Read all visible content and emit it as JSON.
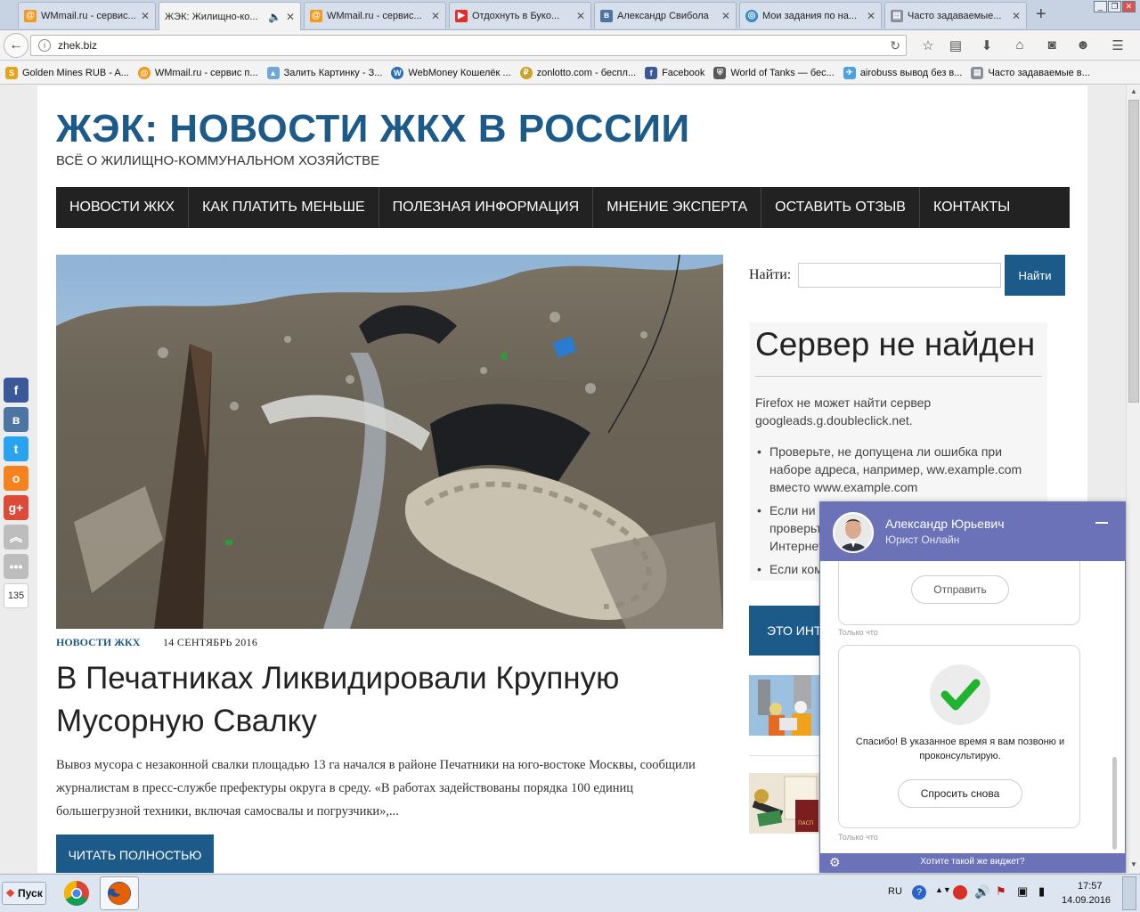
{
  "browser": {
    "tabs": [
      {
        "title": "WMmail.ru - сервис...",
        "icon": "mail-at-icon",
        "active": false
      },
      {
        "title": "ЖЭК: Жилищно-ко...",
        "icon": "page-icon",
        "active": true
      },
      {
        "title": "WMmail.ru - сервис...",
        "icon": "mail-at-icon",
        "active": false
      },
      {
        "title": "Отдохнуть в Буко...",
        "icon": "youtube-icon",
        "active": false
      },
      {
        "title": "Александр Свибола",
        "icon": "vk-icon",
        "active": false
      },
      {
        "title": "Мои задания по на...",
        "icon": "target-icon",
        "active": false
      },
      {
        "title": "Часто задаваемые...",
        "icon": "doc-icon",
        "active": false
      }
    ],
    "new_tab": "+",
    "url": "zhek.biz",
    "bookmarks": [
      {
        "label": "Golden Mines RUB - A..."
      },
      {
        "label": "WMmail.ru - сервис п..."
      },
      {
        "label": "Залить Картинку - З..."
      },
      {
        "label": "WebMoney Кошелёк ..."
      },
      {
        "label": "zonlotto.com - беспл..."
      },
      {
        "label": "Facebook"
      },
      {
        "label": "World of Tanks — бес..."
      },
      {
        "label": "airobuss вывод без в..."
      },
      {
        "label": "Часто задаваемые в..."
      }
    ]
  },
  "site": {
    "title": "ЖЭК: НОВОСТИ ЖКХ В РОССИИ",
    "subtitle": "ВСЁ О ЖИЛИЩНО-КОММУНАЛЬНОМ ХОЗЯЙСТВЕ",
    "nav": [
      "НОВОСТИ ЖКХ",
      "КАК ПЛАТИТЬ МЕНЬШЕ",
      "ПОЛЕЗНАЯ ИНФОРМАЦИЯ",
      "МНЕНИЕ ЭКСПЕРТА",
      "ОСТАВИТЬ ОТЗЫВ",
      "КОНТАКТЫ"
    ]
  },
  "article": {
    "category": "НОВОСТИ ЖКХ",
    "date": "14 СЕНТЯБРЬ 2016",
    "headline": "В Печатниках Ликвидировали Крупную Мусорную Свалку",
    "excerpt": "Вывоз мусора с незаконной свалки площадью 13 га начался в районе Печатники на юго-востоке Москвы, сообщили журналистам в пресс-службе префектуры округа в среду. «В работах задействованы порядка 100 единиц большегрузной техники, включая самосвалы и погрузчики»,...",
    "read_more": "ЧИТАТЬ ПОЛНОСТЬЮ"
  },
  "sidebar": {
    "search_label": "Найти:",
    "search_button": "Найти",
    "error_title": "Сервер не найден",
    "error_desc": "Firefox не может найти сервер googleads.g.doubleclick.net.",
    "error_tips": [
      "Проверьте, не допущена ли ошибка при наборе адреса, например, ww.example.com вместо www.example.com",
      "Если ни одна из страниц не загружается – проверьте подключение компьютера к сети Интернет.",
      "Если компьютер или сеть защищены межсетевым экраном или прокси-сервером – убедитесь, что Firefox разрешён выход в Интернет."
    ],
    "band_text": "ЭТО ИНТ"
  },
  "social": {
    "count": "135"
  },
  "chat": {
    "name": "Александр Юрьевич",
    "role": "Юрист Онлайн",
    "send_button": "Отправить",
    "timestamp": "Только что",
    "thanks": "Спасибо! В указанное время я вам позвоню и проконсультирую.",
    "ask_again": "Спросить снова",
    "timestamp2": "Только что",
    "footer": "Хотите такой же виджет?"
  },
  "taskbar": {
    "start": "Пуск",
    "lang": "RU",
    "time": "17:57",
    "date": "14.09.2016"
  },
  "colors": {
    "brand_blue": "#1c5a8a",
    "nav_dark": "#222222",
    "chat_purple": "#6b72b7"
  }
}
